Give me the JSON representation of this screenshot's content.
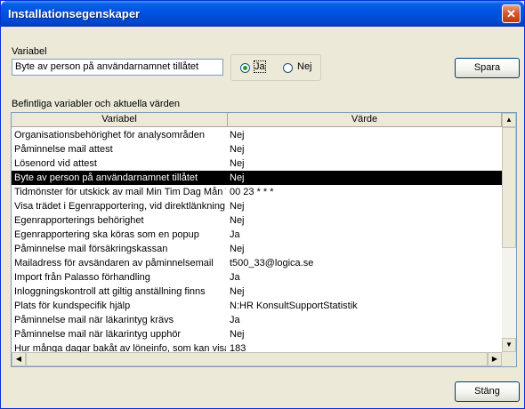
{
  "window": {
    "title": "Installationsegenskaper",
    "close_glyph": "✕"
  },
  "variable_section": {
    "label": "Variabel",
    "value": "Byte av person på användarnamnet tillåtet",
    "radio_yes": "Ja",
    "radio_no": "Nej",
    "selected": "Ja",
    "save_button": "Spara"
  },
  "list": {
    "caption": "Befintliga variabler och aktuella värden",
    "columns": [
      "Variabel",
      "Värde"
    ],
    "rows": [
      [
        "Organisationsbehörighet för analysområden",
        "Nej"
      ],
      [
        "Påminnelse mail attest",
        "Nej"
      ],
      [
        "Lösenord vid attest",
        "Nej"
      ],
      [
        "Byte av person på användarnamnet tillåtet",
        "Nej"
      ],
      [
        "Tidmönster för utskick av mail  Min Tim Dag Mån V",
        "00 23 * * *"
      ],
      [
        "Visa trädet i Egenrapportering, vid direktlänkning till",
        "Nej"
      ],
      [
        "Egenrapporterings behörighet",
        "Nej"
      ],
      [
        "Egenrapportering ska köras som en popup",
        "Ja"
      ],
      [
        "Påminnelse mail försäkringskassan",
        "Nej"
      ],
      [
        "Mailadress för avsändaren av påminnelsemail",
        "t500_33@logica.se"
      ],
      [
        "Import från Palasso förhandling",
        "Ja"
      ],
      [
        "Inloggningskontroll att giltig anställning finns",
        "Nej"
      ],
      [
        "Plats för kundspecifik hjälp",
        "N:HR KonsultSupportStatistik"
      ],
      [
        "Påminnelse mail när läkarintyg krävs",
        "Ja"
      ],
      [
        "Påminnelse mail när läkarintyg upphör",
        "Nej"
      ],
      [
        "Hur många dagar bakåt av löneinfo, som kan visas",
        "183"
      ]
    ],
    "selected_row": 3
  },
  "close_button": "Stäng",
  "icons": {
    "scroll_up": "up-arrow-icon",
    "scroll_down": "down-arrow-icon",
    "scroll_left": "left-arrow-icon",
    "scroll_right": "right-arrow-icon"
  }
}
